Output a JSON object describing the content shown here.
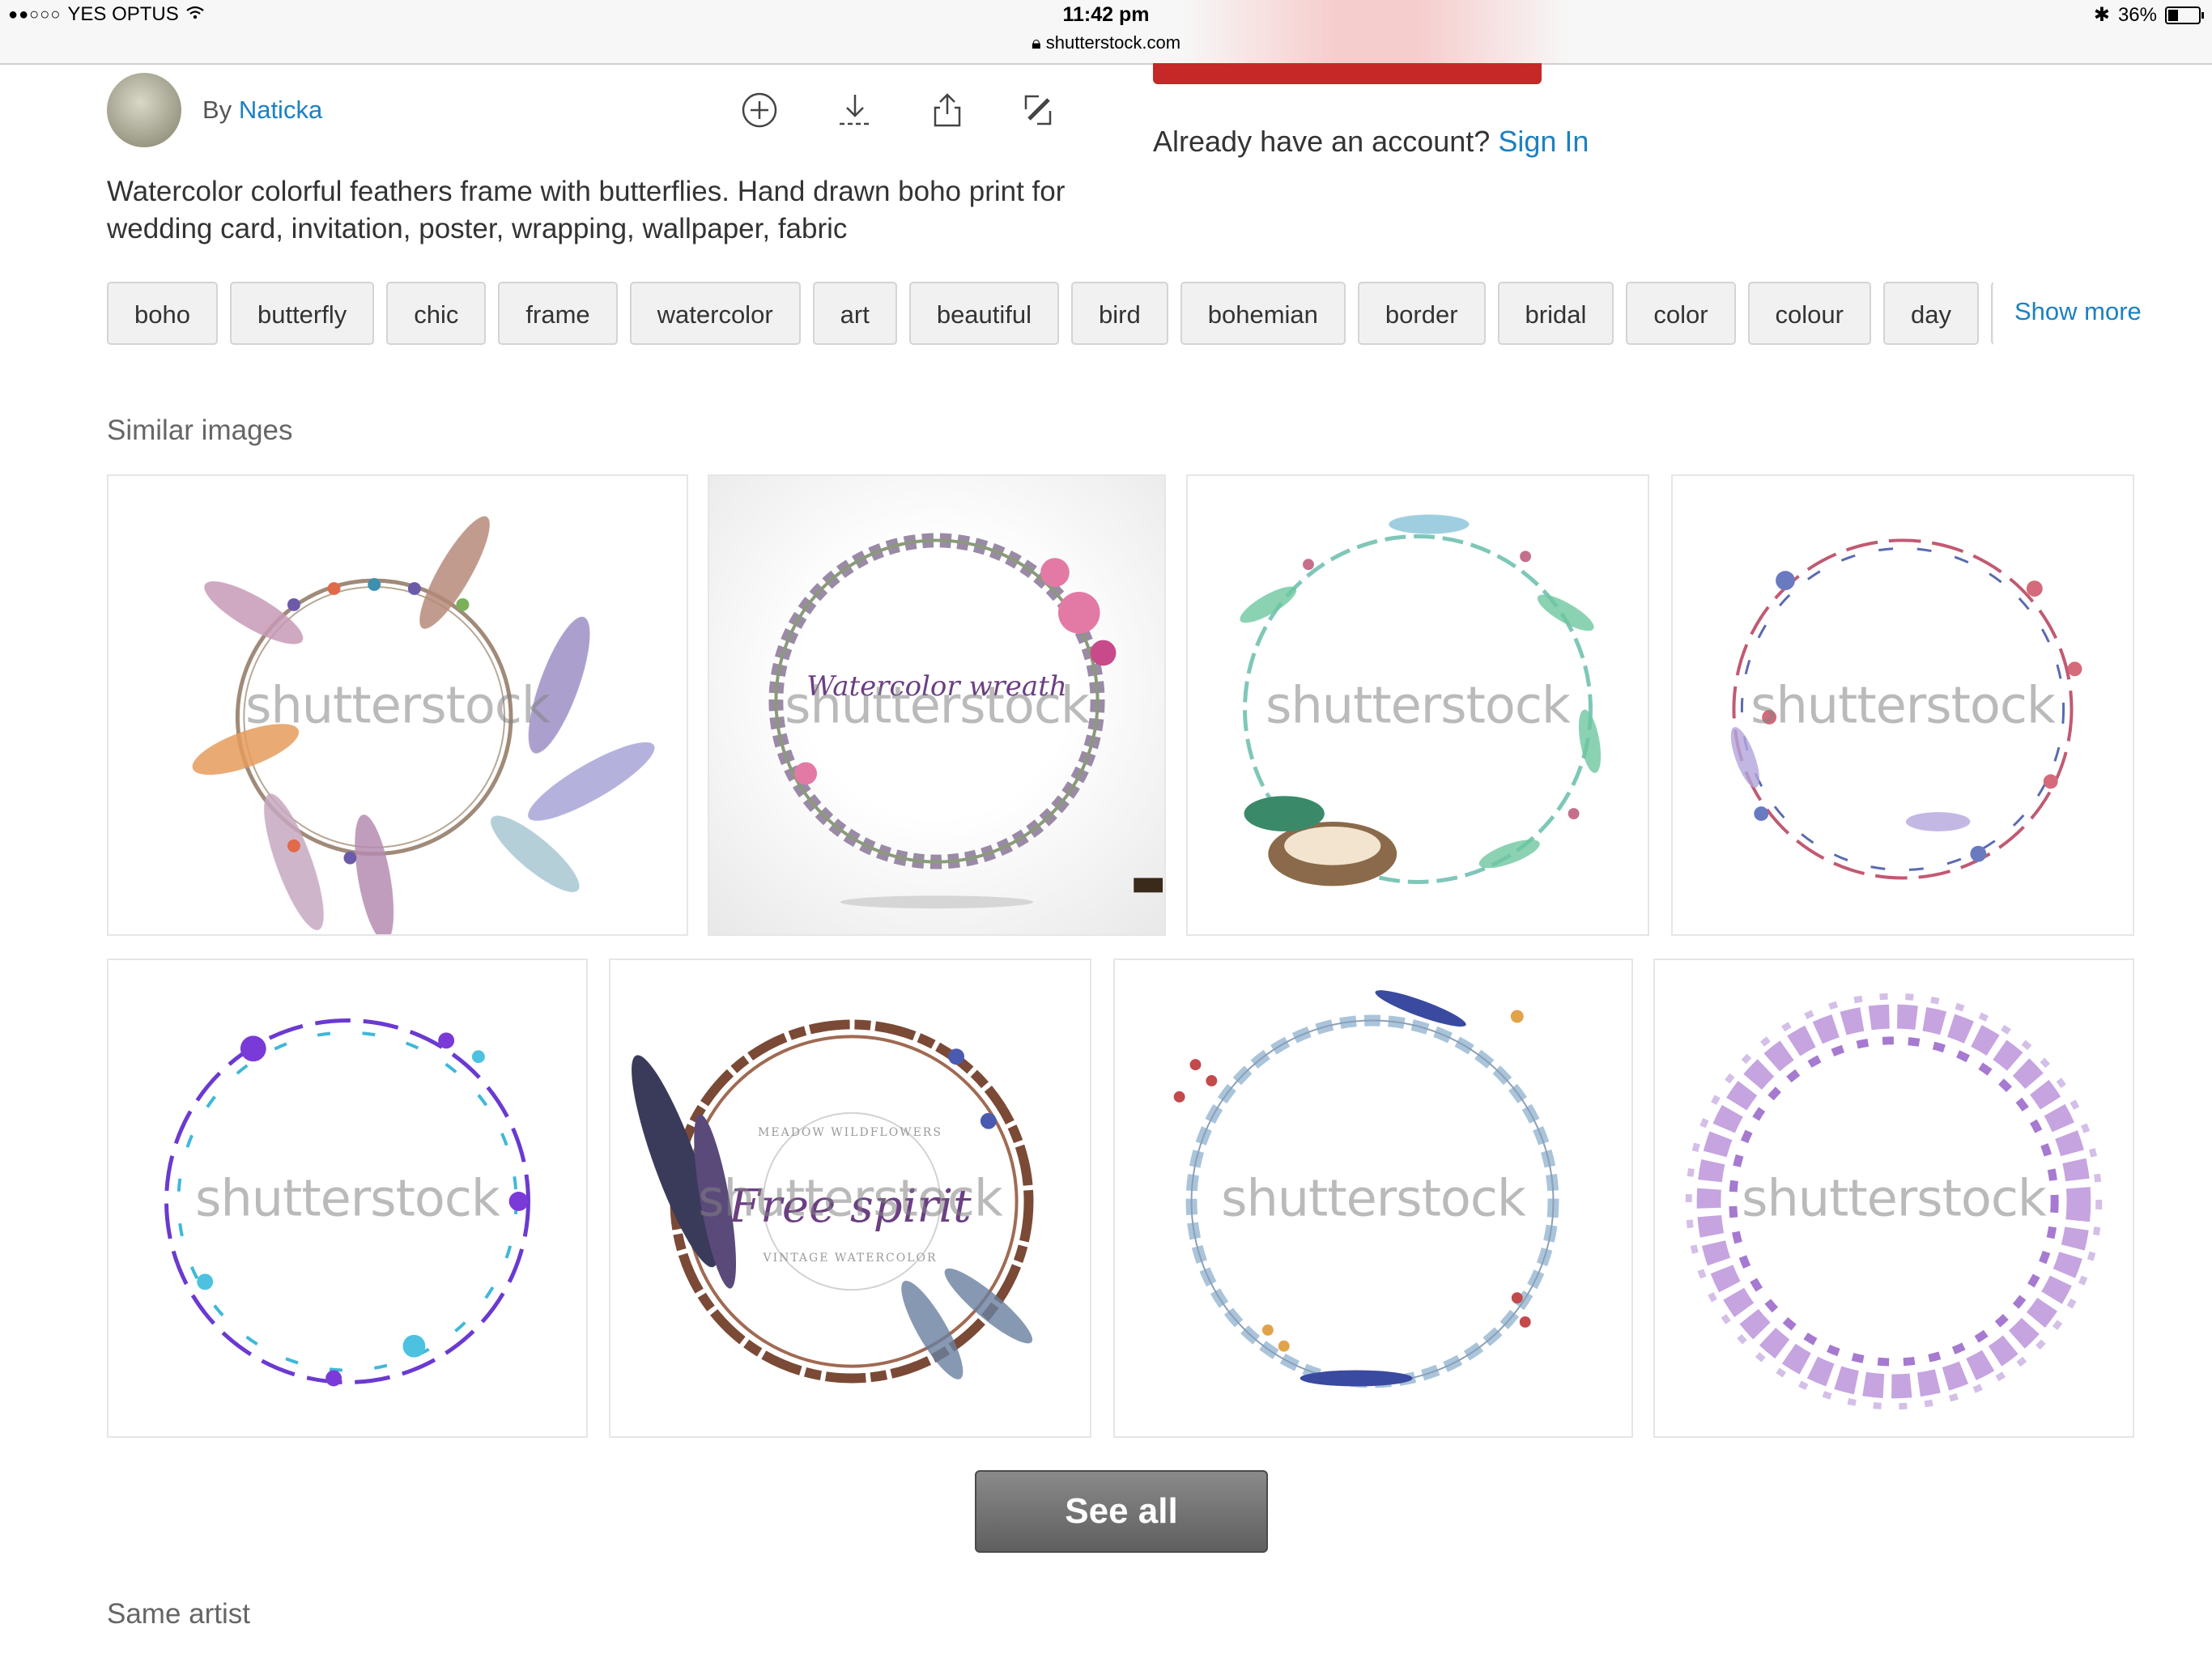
{
  "status_bar": {
    "carrier": "YES OPTUS",
    "time": "11:42 pm",
    "url": "shutterstock.com",
    "battery": "36%",
    "battery_level": 0.36
  },
  "author": {
    "prefix": "By",
    "name": "Naticka"
  },
  "toolbar_icons": [
    "add-circle-icon",
    "download-icon",
    "share-icon",
    "edit-icon"
  ],
  "account": {
    "prompt": "Already have an account?",
    "sign_in": "Sign In"
  },
  "description": "Watercolor colorful feathers frame with butterflies. Hand drawn boho print for wedding card, invitation, poster, wrapping, wallpaper, fabric",
  "keywords": [
    "boho",
    "butterfly",
    "chic",
    "frame",
    "watercolor",
    "art",
    "beautiful",
    "bird",
    "bohemian",
    "border",
    "bridal",
    "color",
    "colour",
    "day"
  ],
  "show_more": "Show more",
  "similar_images": {
    "title": "Similar images",
    "watermark": "shutterstock",
    "items": [
      {
        "alt": "feather dreamcatcher wreath"
      },
      {
        "alt": "watercolor wreath with flowers",
        "caption": "Watercolor wreath"
      },
      {
        "alt": "green leaf wreath with nest"
      },
      {
        "alt": "red and blue floral wreath"
      },
      {
        "alt": "purple and blue floral wreath"
      },
      {
        "alt": "twig wreath with feathers",
        "caption": "Free spirit",
        "ring_text_top": "MEADOW WILDFLOWERS",
        "ring_text_bottom": "VINTAGE WATERCOLOR"
      },
      {
        "alt": "eucalyptus wreath with berries"
      },
      {
        "alt": "lavender leaf wreath"
      }
    ]
  },
  "see_all": "See all",
  "same_artist": {
    "title": "Same artist"
  },
  "colors": {
    "link": "#1a81c2",
    "accent_red": "#c62828",
    "button_gray": "#6f6f6f"
  }
}
